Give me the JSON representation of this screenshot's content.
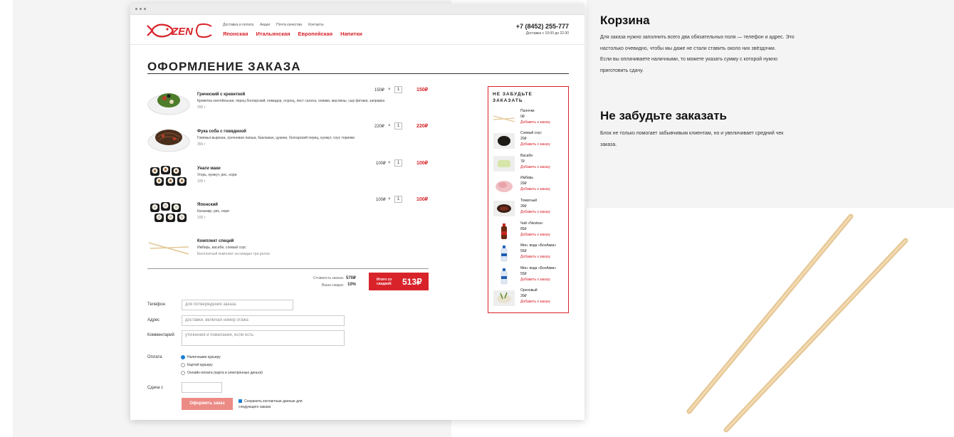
{
  "header": {
    "top_links": [
      "Доставка и оплата",
      "Акции",
      "Почта качества",
      "Контакты"
    ],
    "categories": [
      "Японская",
      "Итальянская",
      "Европейская",
      "Напитки"
    ],
    "phone": "+7 (8452) 255-777",
    "hours": "Доставка с 10:00 до 22:30"
  },
  "order": {
    "title": "ОФОРМЛЕНИЕ ЗАКАЗА",
    "items": [
      {
        "name": "Греческий с креветкой",
        "desc": "Креветка коктейльная, перец болгарский, помидор, огурец, лист салата, оливки, маслины, сыр фетаки, заправка",
        "weight": "200 г",
        "price": "150₽",
        "mult": "×",
        "qty": "1",
        "total": "150₽"
      },
      {
        "name": "Фука соба с говядиной",
        "desc": "Говяжья вырезка, гречневая лапша, баклажан, цукини, болгарский перец, кунжут, соус терияки",
        "weight": "350 г",
        "price": "220₽",
        "mult": "×",
        "qty": "1",
        "total": "220₽"
      },
      {
        "name": "Унаги маки",
        "desc": "Угорь, кунжут, рис, нори",
        "weight": "100 г",
        "price": "100₽",
        "mult": "×",
        "qty": "1",
        "total": "100₽"
      },
      {
        "name": "Японский",
        "desc": "Кальмар, рис, нори",
        "weight": "100 г",
        "price": "100₽",
        "mult": "×",
        "qty": "1",
        "total": "100₽"
      },
      {
        "name": "Комплект специй",
        "desc": "Имбирь, васаби, соевый соус",
        "weight": "Бесплатный комплект на каждые три ролла"
      }
    ],
    "summary": {
      "cost_label": "Стоимость заказа:",
      "cost_value": "570₽",
      "discount_label": "Ваша скидка:",
      "discount_value": "10%",
      "total_label": "Итого со скидкой:",
      "total_value": "513₽"
    }
  },
  "form": {
    "phone_label": "Телефон",
    "phone_placeholder": "для потверждения заказа",
    "address_label": "Адрес",
    "address_placeholder": "доставки, включая номер этажа",
    "comment_label": "Комментарий",
    "comment_placeholder": "уточнения и пожелания, если есть",
    "payment_label": "Оплата",
    "payment_options": [
      "Наличными курьеру",
      "Картой курьеру",
      "Онлайн-оплата (карта и электронные деньги)"
    ],
    "payment_selected": "Наличными курьеру",
    "change_label": "Сдача с",
    "submit_label": "Оформить заказ",
    "save_label": "Сохранить контактные данные для следующего заказа"
  },
  "sidebar": {
    "title": "НЕ ЗАБУДЬТЕ ЗАКАЗАТЬ",
    "add_label": "Добавить к заказу",
    "items": [
      {
        "name": "Палочки",
        "price": "0₽",
        "icon": "chopsticks-icon"
      },
      {
        "name": "Соевый соус",
        "price": "20₽",
        "icon": "soy-sauce-icon"
      },
      {
        "name": "Васаби",
        "price": "7₽",
        "icon": "wasabi-icon"
      },
      {
        "name": "Имбирь",
        "price": "20₽",
        "icon": "ginger-icon"
      },
      {
        "name": "Томатный",
        "price": "30₽",
        "icon": "tomato-sauce-icon"
      },
      {
        "name": "Чай «Nestea»",
        "price": "85₽",
        "icon": "tea-bottle-icon"
      },
      {
        "name": "Мин. вода «БонАква»",
        "price": "55₽",
        "icon": "water-bottle-icon"
      },
      {
        "name": "Мин. вода «БонАква»",
        "price": "55₽",
        "icon": "water-bottle-icon"
      },
      {
        "name": "Ореховый",
        "price": "30₽",
        "icon": "nut-sauce-icon"
      }
    ]
  },
  "description": {
    "cart_title": "Корзина",
    "cart_text": [
      "Для заказа нужно заполнить всего два обязательных поля — телефон и адрес. Это",
      "настолько очевидно, чтобы мы даже не стали ставить около них звёздочки.",
      "Если вы оплачиваете наличными, то можете указать сумму с которой нужно",
      "приготовить сдачу."
    ],
    "upsell_title": "Не забудьте заказать",
    "upsell_text": [
      "Блок не только помогает забывчивым клиентам, но и увеличивает средний чек",
      "заказа."
    ]
  },
  "colors": {
    "brand_red": "#d8232a",
    "radio_blue": "#1a7fd6",
    "submit_pink": "#ec8b86"
  }
}
